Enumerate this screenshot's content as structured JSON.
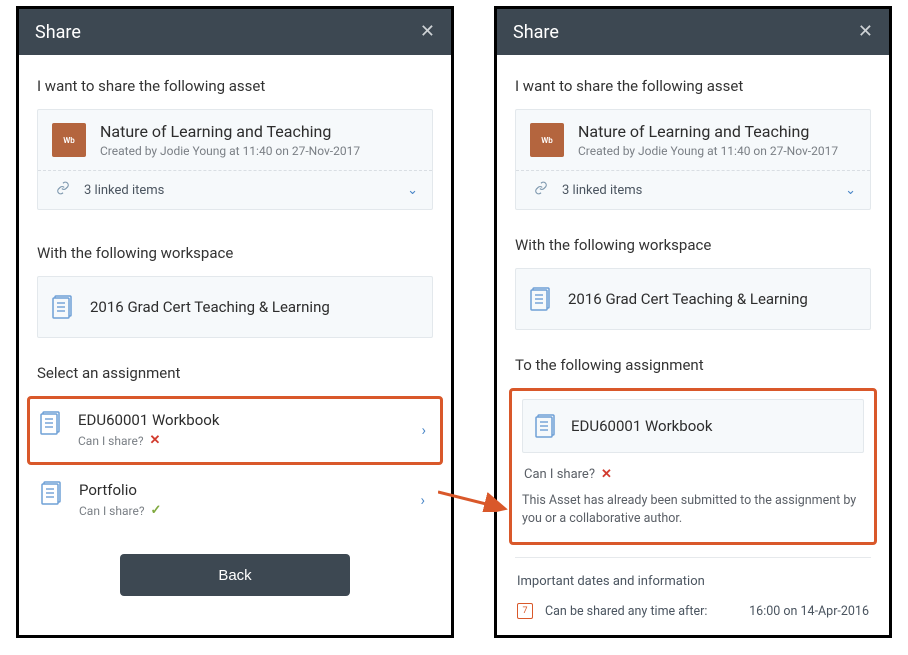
{
  "left": {
    "title": "Share",
    "heading_asset": "I want to share the following asset",
    "asset": {
      "badge": "Wb",
      "title": "Nature of Learning and Teaching",
      "created": "Created by Jodie Young at 11:40 on 27-Nov-2017"
    },
    "linked_items": "3 linked items",
    "heading_workspace": "With the following workspace",
    "workspace": "2016 Grad Cert Teaching & Learning",
    "heading_select": "Select an assignment",
    "assignments": [
      {
        "title": "EDU60001 Workbook",
        "share_q": "Can I share?",
        "ok": false
      },
      {
        "title": "Portfolio",
        "share_q": "Can I share?",
        "ok": true
      }
    ],
    "back": "Back"
  },
  "right": {
    "title": "Share",
    "heading_asset": "I want to share the following asset",
    "asset": {
      "badge": "Wb",
      "title": "Nature of Learning and Teaching",
      "created": "Created by Jodie Young at 11:40 on 27-Nov-2017"
    },
    "linked_items": "3 linked items",
    "heading_workspace": "With the following workspace",
    "workspace": "2016 Grad Cert Teaching & Learning",
    "heading_assignment": "To the following assignment",
    "assignment_title": "EDU60001 Workbook",
    "share_q": "Can I share?",
    "explain": "This Asset has already been submitted to the assignment by you or a collaborative author.",
    "dates_heading": "Important dates and information",
    "dates_label": "Can be shared any time after:",
    "dates_value": "16:00 on 14-Apr-2016"
  }
}
